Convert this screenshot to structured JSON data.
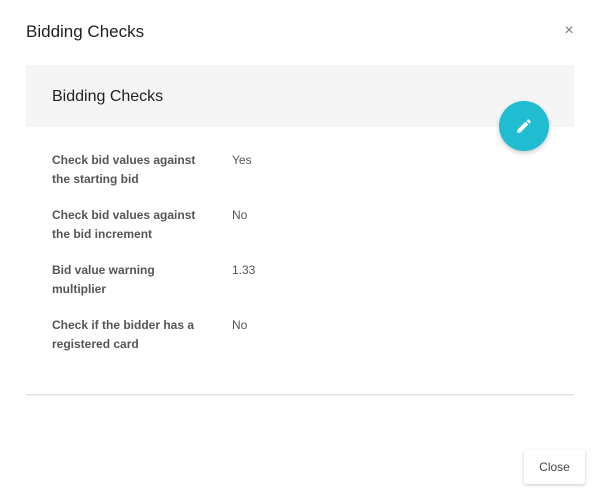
{
  "dialog": {
    "title": "Bidding Checks",
    "close_icon_glyph": "×",
    "close_icon": "close-icon"
  },
  "card": {
    "title": "Bidding Checks",
    "edit_icon": "pencil-icon",
    "edit_button_color": "#1fbcd2",
    "rows": [
      {
        "label": "Check bid values against the starting bid",
        "value": "Yes"
      },
      {
        "label": "Check bid values against the bid increment",
        "value": "No"
      },
      {
        "label": "Bid value warning multiplier",
        "value": "1.33"
      },
      {
        "label": "Check if the bidder has a registered card",
        "value": "No"
      }
    ]
  },
  "footer": {
    "close_label": "Close"
  }
}
